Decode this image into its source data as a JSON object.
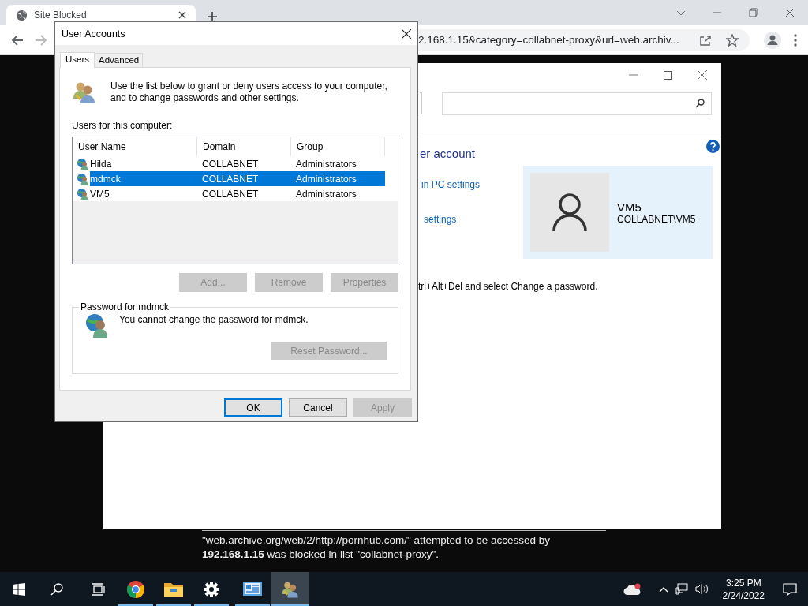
{
  "browser": {
    "tab": {
      "title": "Site Blocked"
    },
    "address": "2.168.1.15&category=collabnet-proxy&url=web.archiv..."
  },
  "control_panel": {
    "heading": "er account",
    "links": [
      "in PC settings",
      "settings"
    ],
    "user": {
      "name": "VM5",
      "account": "COLLABNET\\VM5"
    },
    "note": "trl+Alt+Del and select Change a password."
  },
  "block_message": {
    "text": "\"web.archive.org/web/2/http://pornhub.com/\" attempted to be accessed by **192.168.1.15** was blocked in list \"collabnet-proxy\"."
  },
  "dialog": {
    "title": "User Accounts",
    "tabs": [
      {
        "label": "Users",
        "selected": true
      },
      {
        "label": "Advanced",
        "selected": false
      }
    ],
    "intro": "Use the list below to grant or deny users access to your computer, and to change passwords and other settings.",
    "list_label": "Users for this computer:",
    "columns": [
      "User Name",
      "Domain",
      "Group"
    ],
    "rows": [
      {
        "cells": [
          "Hilda",
          "COLLABNET",
          "Administrators"
        ],
        "selected": false
      },
      {
        "cells": [
          "mdmck",
          "COLLABNET",
          "Administrators"
        ],
        "selected": true
      },
      {
        "cells": [
          "VM5",
          "COLLABNET",
          "Administrators"
        ],
        "selected": false
      }
    ],
    "list_buttons": [
      {
        "label": "Add...",
        "disabled": true
      },
      {
        "label": "Remove",
        "disabled": true
      },
      {
        "label": "Properties",
        "disabled": true
      }
    ],
    "password_group": {
      "title": "Password for mdmck",
      "message": "You cannot change the password for mdmck.",
      "button": {
        "label": "Reset Password...",
        "disabled": true
      }
    },
    "buttons": [
      {
        "label": "OK",
        "disabled": false,
        "default": true
      },
      {
        "label": "Cancel",
        "disabled": false,
        "default": false
      },
      {
        "label": "Apply",
        "disabled": true,
        "default": false
      }
    ]
  },
  "taskbar": {
    "items": [
      {
        "kind": "start",
        "running": false,
        "selected": false
      },
      {
        "kind": "search",
        "running": false,
        "selected": false
      },
      {
        "kind": "taskview",
        "running": false,
        "selected": false
      },
      {
        "kind": "chrome",
        "running": true,
        "selected": false
      },
      {
        "kind": "folder",
        "running": true,
        "selected": false
      },
      {
        "kind": "settings",
        "running": true,
        "selected": false
      },
      {
        "kind": "controlpanel",
        "running": true,
        "selected": false
      },
      {
        "kind": "users",
        "running": true,
        "selected": true
      }
    ],
    "time": "3:25 PM",
    "date": "2/24/2022"
  }
}
